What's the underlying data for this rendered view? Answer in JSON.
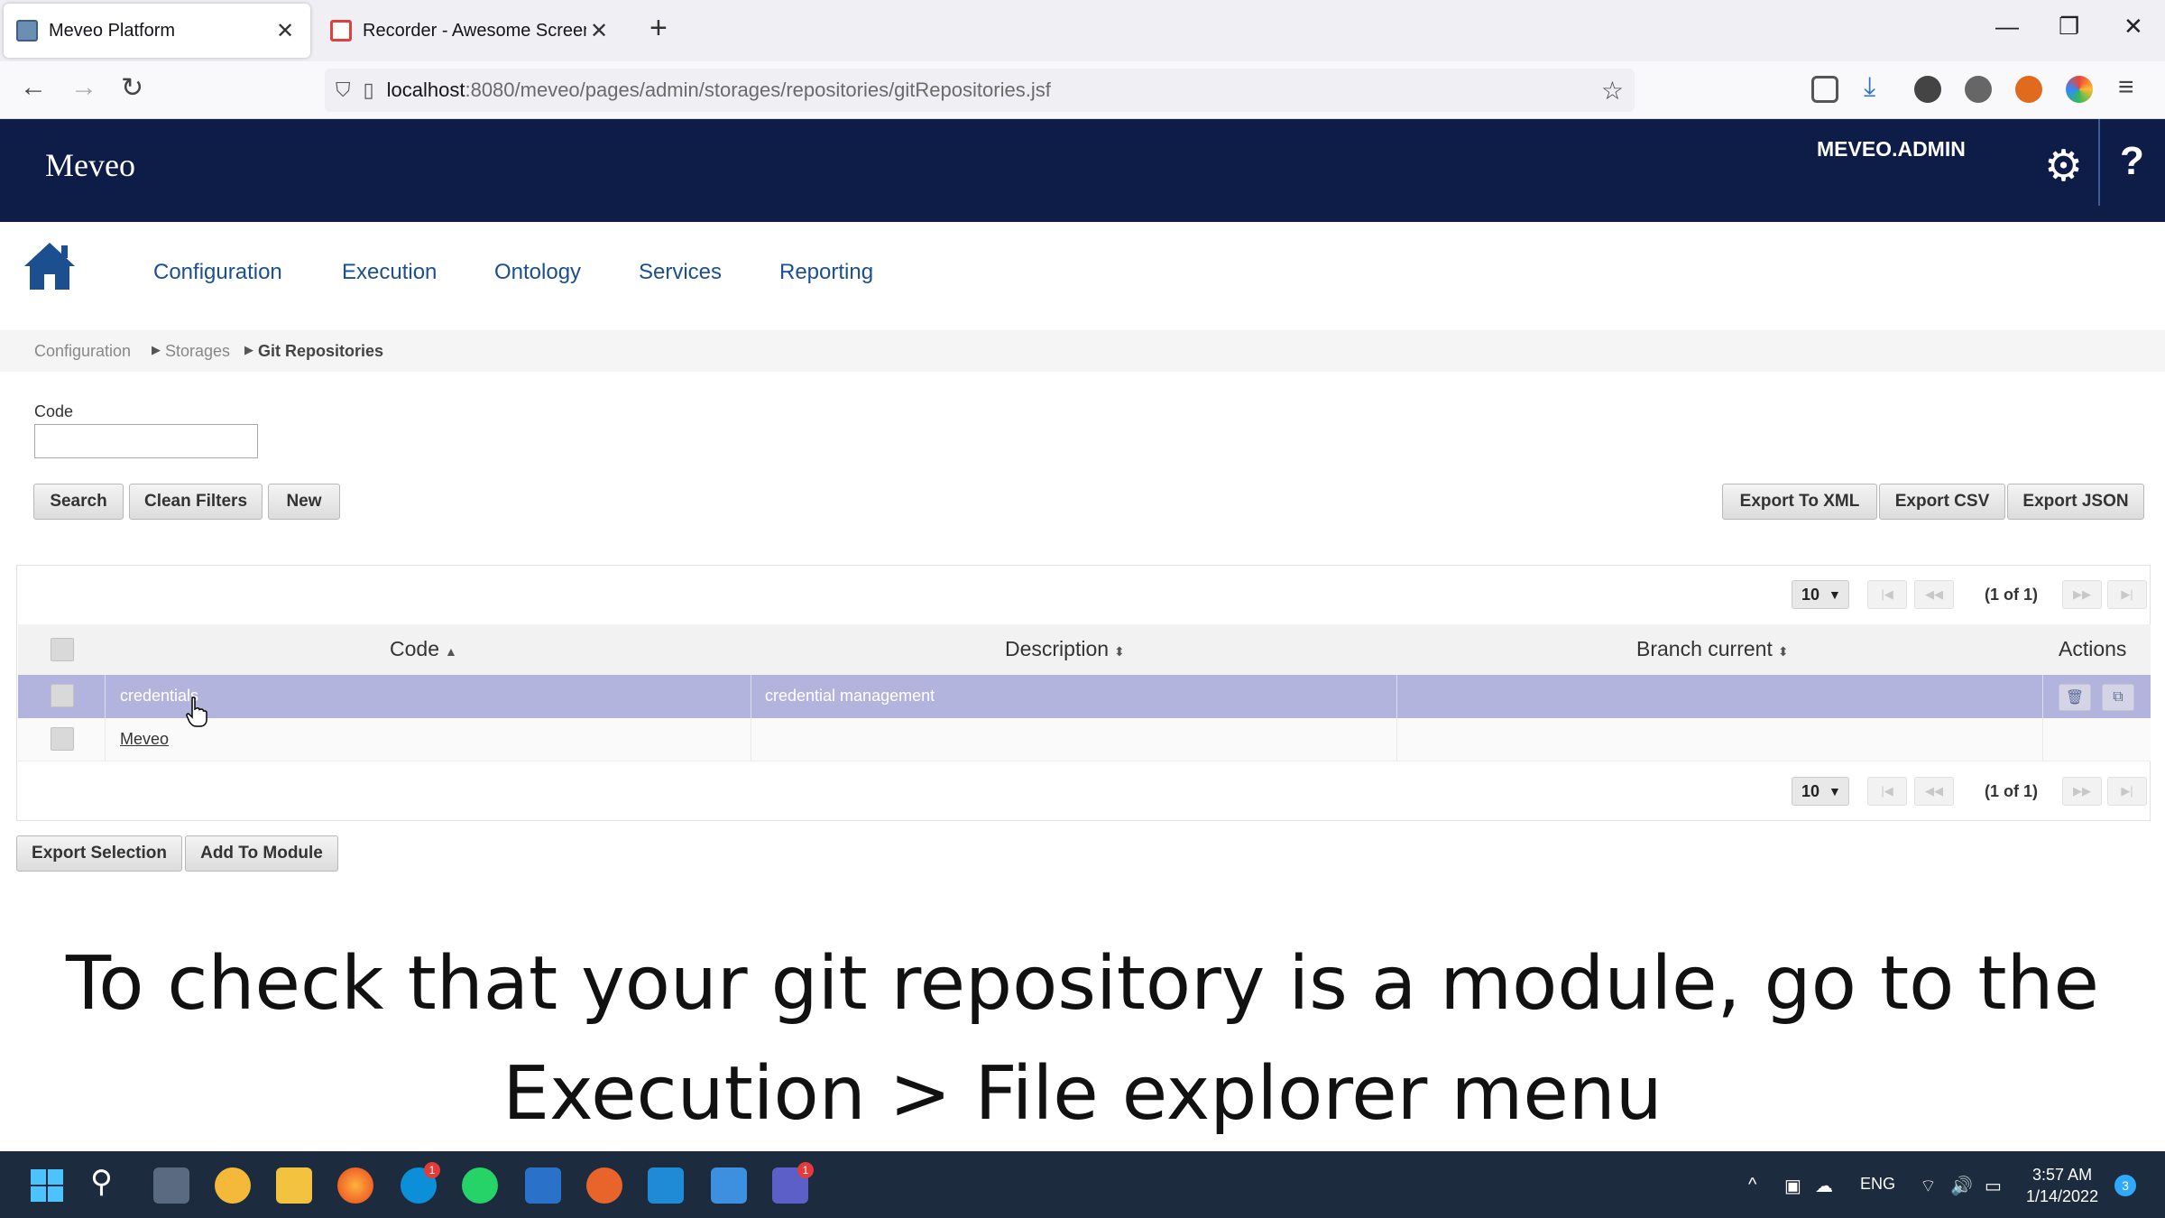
{
  "browser": {
    "tabs": [
      {
        "title": "Meveo Platform",
        "active": true
      },
      {
        "title": "Recorder - Awesome Screenshc",
        "active": false
      }
    ],
    "url_host": "localhost",
    "url_path": ":8080/meveo/pages/admin/storages/repositories/gitRepositories.jsf"
  },
  "app": {
    "brand": "Meveo",
    "user": "MEVEO.ADMIN",
    "help": "?"
  },
  "menu": [
    "Configuration",
    "Execution",
    "Ontology",
    "Services",
    "Reporting"
  ],
  "breadcrumb": [
    "Configuration",
    "Storages",
    "Git Repositories"
  ],
  "filter": {
    "code_label": "Code",
    "code_value": "",
    "buttons": {
      "search": "Search",
      "clean": "Clean Filters",
      "new": "New"
    },
    "exports": {
      "xml": "Export To XML",
      "csv": "Export CSV",
      "json": "Export JSON"
    }
  },
  "table": {
    "rows_per_page": "10",
    "page_info": "(1 of 1)",
    "columns": {
      "code": "Code",
      "description": "Description",
      "branch": "Branch current",
      "actions": "Actions"
    },
    "rows": [
      {
        "code": "credentials",
        "description": "credential management",
        "branch": "",
        "selected": true
      },
      {
        "code": "Meveo",
        "description": "",
        "branch": "",
        "selected": false
      }
    ]
  },
  "bottom_buttons": {
    "export_selection": "Export Selection",
    "add_to_module": "Add To Module"
  },
  "caption": {
    "line1": "To check that your git repository is a module, go to the",
    "line2": "Execution > File explorer menu"
  },
  "taskbar": {
    "language": "ENG",
    "time": "3:57 AM",
    "date": "1/14/2022",
    "notifications": "3",
    "skype_badge": "1",
    "teams_badge": "1"
  },
  "colors": {
    "header_bg": "#0e1d47",
    "link": "#1b4f8f",
    "selected_row": "#b3b4de",
    "taskbar_bg": "#1d2b3e"
  }
}
